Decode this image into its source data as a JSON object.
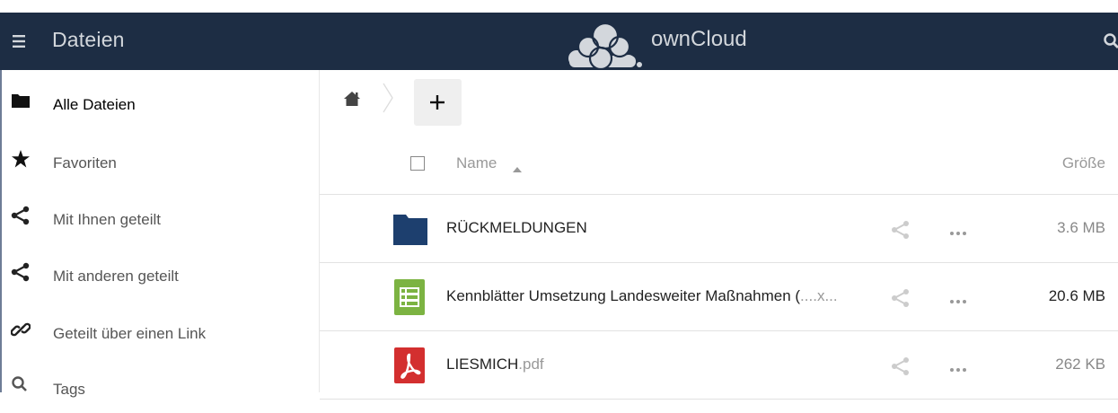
{
  "header": {
    "app_title": "Dateien",
    "logo_text": "ownCloud",
    "bg_color": "#1d2d44"
  },
  "sidebar": {
    "items": [
      {
        "label": "Alle Dateien",
        "icon": "folder-icon",
        "active": true
      },
      {
        "label": "Favoriten",
        "icon": "star-icon"
      },
      {
        "label": "Mit Ihnen geteilt",
        "icon": "share-icon"
      },
      {
        "label": "Mit anderen geteilt",
        "icon": "share-icon"
      },
      {
        "label": "Geteilt über einen Link",
        "icon": "link-icon"
      },
      {
        "label": "Tags",
        "icon": "search-icon"
      }
    ]
  },
  "controls": {
    "new_label": "+"
  },
  "table": {
    "col_name": "Name",
    "col_size": "Größe",
    "rows": [
      {
        "name": "RÜCKMELDUNGEN",
        "ext": "",
        "size": "3.6 MB",
        "type": "folder",
        "size_color": "#888888"
      },
      {
        "name": "Kennblätter Umsetzung Landesweiter Maßnahmen (",
        "ext": "....x...",
        "size": "20.6 MB",
        "type": "spreadsheet",
        "size_color": "#222222"
      },
      {
        "name": "LIESMICH",
        "ext": ".pdf",
        "size": "262 KB",
        "type": "pdf",
        "size_color": "#888888"
      }
    ]
  }
}
